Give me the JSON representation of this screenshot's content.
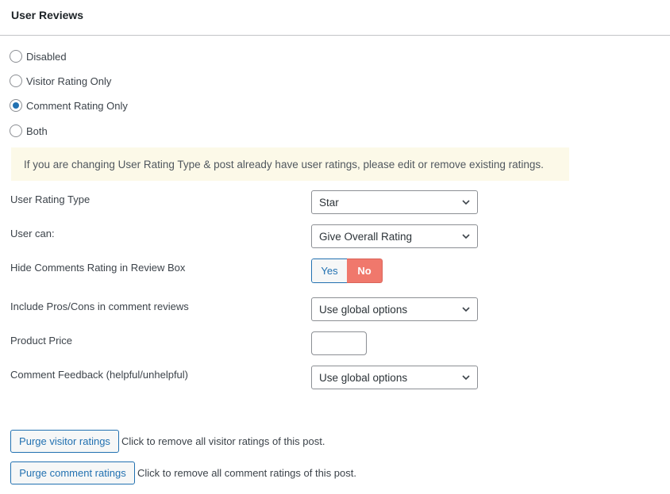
{
  "panel": {
    "title": "User Reviews"
  },
  "user_reviews": {
    "options": [
      {
        "label": "Disabled",
        "checked": false
      },
      {
        "label": "Visitor Rating Only",
        "checked": false
      },
      {
        "label": "Comment Rating Only",
        "checked": true
      },
      {
        "label": "Both",
        "checked": false
      }
    ]
  },
  "notice": {
    "text": "If you are changing User Rating Type & post already have user ratings, please edit or remove existing ratings."
  },
  "fields": {
    "rating_type": {
      "label": "User Rating Type",
      "value": "Star"
    },
    "user_can": {
      "label": "User can:",
      "value": "Give Overall Rating"
    },
    "hide_comments": {
      "label": "Hide Comments Rating in Review Box",
      "yes": "Yes",
      "no": "No",
      "selected": "No"
    },
    "pros_cons": {
      "label": "Include Pros/Cons in comment reviews",
      "value": "Use global options"
    },
    "product_price": {
      "label": "Product Price",
      "value": ""
    },
    "comment_feedback": {
      "label": "Comment Feedback (helpful/unhelpful)",
      "value": "Use global options"
    }
  },
  "actions": {
    "purge_visitor": {
      "button": "Purge visitor ratings",
      "hint": "Click to remove all visitor ratings of this post."
    },
    "purge_comment": {
      "button": "Purge comment ratings",
      "hint": "Click to remove all comment ratings of this post."
    }
  },
  "colors": {
    "accent": "#2271b1",
    "no_active": "#f0786c",
    "notice_bg": "#fcf9e8"
  },
  "icons": {
    "select_arrow": "chevron-down-icon"
  }
}
